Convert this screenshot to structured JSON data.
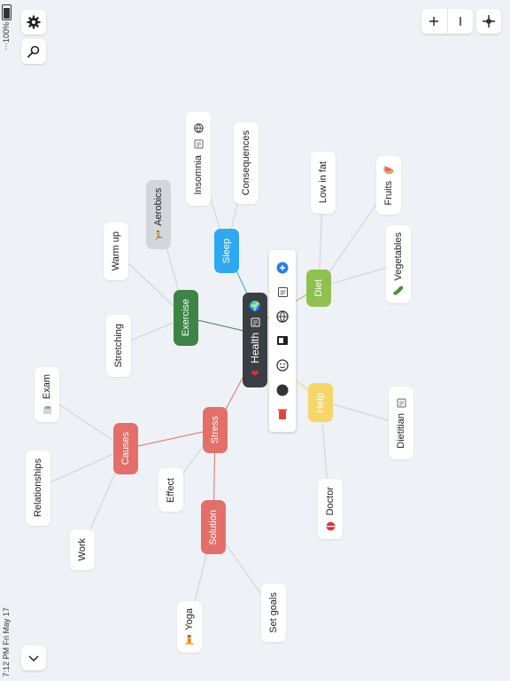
{
  "status": {
    "time": "7:12 PM",
    "date": "Fri May 17",
    "battery": "100%"
  },
  "colors": {
    "health": "#3a3f44",
    "exercise": "#3e8446",
    "sleep": "#2fa8ef",
    "diet": "#8fc050",
    "help": "#f6d66b",
    "stress": "#e36f6a",
    "aerobics": "#d3d6da"
  },
  "nodes": {
    "health": "Health",
    "sleep": "Sleep",
    "insomnia": "Insomnia",
    "consequences": "Consequences",
    "exercise": "Exercise",
    "aerobics": "Aerobics",
    "warm_up": "Warm up",
    "stretching": "Stretching",
    "diet": "Diet",
    "low_in_fat": "Low in fat",
    "fruits": "Fruits",
    "vegetables": "Vegetables",
    "help": "Help",
    "dietitian": "Dietitian",
    "doctor": "Doctor",
    "stress": "Stress",
    "causes": "Causes",
    "exam": "Exam",
    "relationships": "Relationships",
    "work": "Work",
    "effect": "Effect",
    "solution": "Solution",
    "yoga": "Yoga",
    "set_goals": "Set goals"
  },
  "icons": {
    "settings": "gear-icon",
    "search": "search-icon",
    "zoom_in": "plus-icon",
    "zoom_out": "minus-icon",
    "fit": "crosshair-icon",
    "collapse": "chevron-down-icon"
  }
}
